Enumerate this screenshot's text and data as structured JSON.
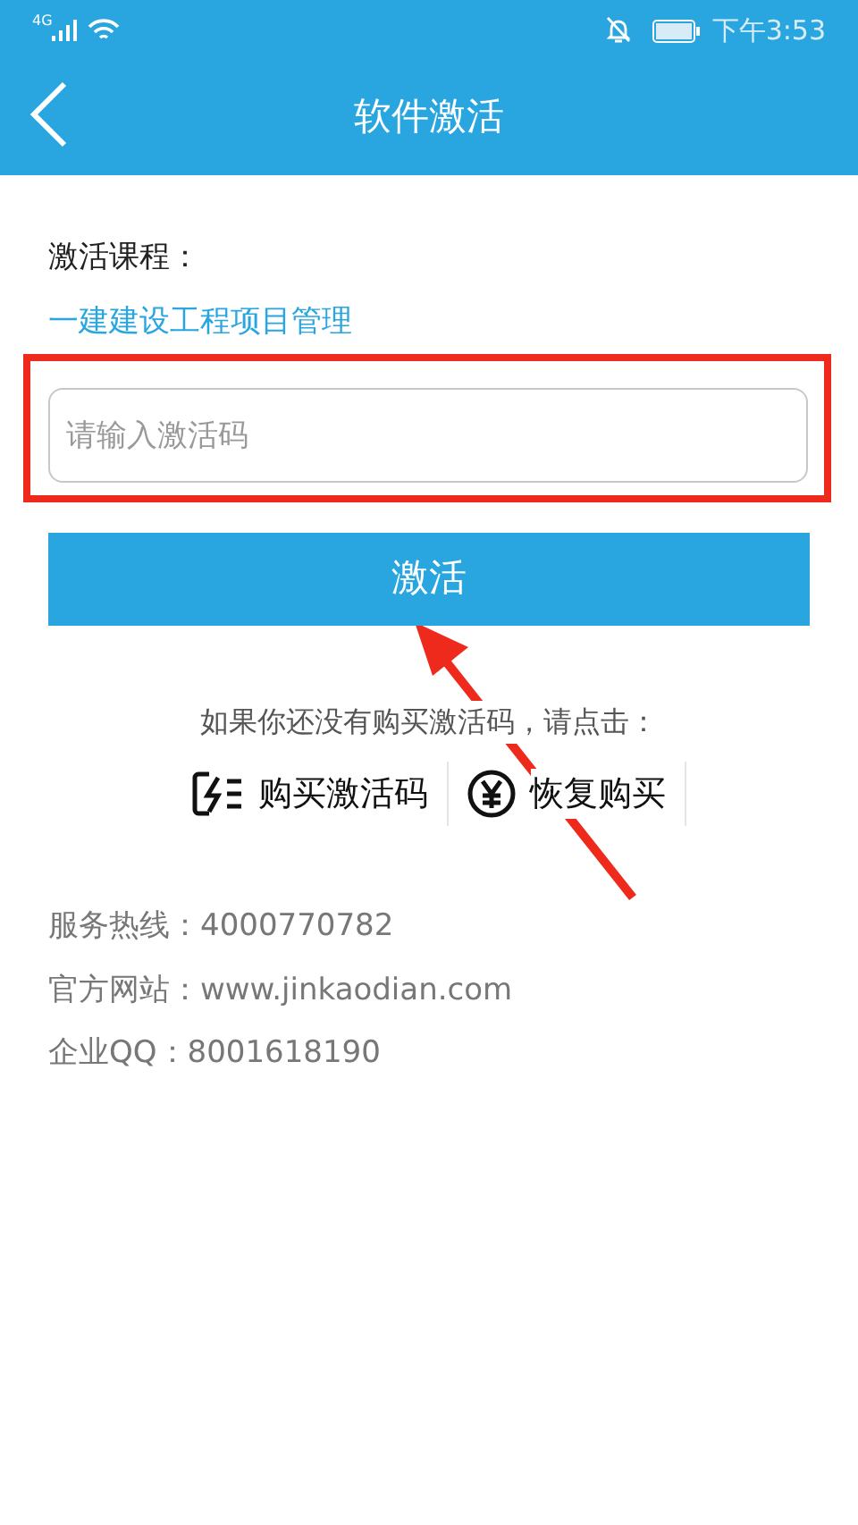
{
  "status_bar": {
    "network": "4G",
    "time": "下午3:53"
  },
  "header": {
    "title": "软件激活"
  },
  "course": {
    "label": "激活课程：",
    "name": "一建建设工程项目管理"
  },
  "code_field": {
    "placeholder": "请输入激活码"
  },
  "activate_button": "激活",
  "prompt": "如果你还没有购买激活码，请点击：",
  "actions": [
    {
      "kind": "buy",
      "label": "购买激活码"
    },
    {
      "kind": "restore",
      "label": "恢复购买"
    }
  ],
  "contacts": [
    "服务热线：4000770782",
    "官方网站：www.jinkaodian.com",
    "企业QQ：8001618190"
  ]
}
